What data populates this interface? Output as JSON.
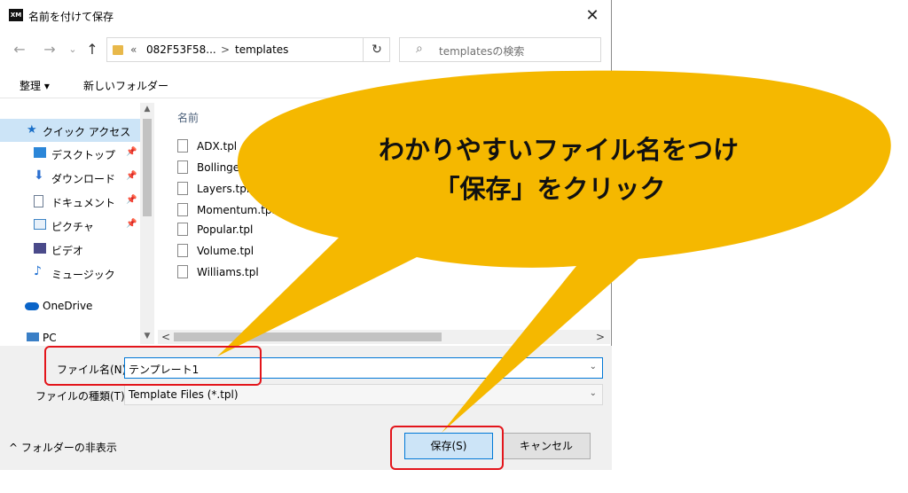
{
  "window": {
    "app_icon": "XM",
    "title": "名前を付けて保存",
    "close_glyph": "✕"
  },
  "nav": {
    "back_glyph": "←",
    "forward_glyph": "→",
    "down_glyph": "⌄",
    "up_glyph": "↑",
    "address": {
      "overflow": "«",
      "segment1": "082F53F58...",
      "chevron": ">",
      "segment2": "templates"
    },
    "refresh_glyph": "↻",
    "search_placeholder": "templatesの検索"
  },
  "toolbar": {
    "organize": "整理 ▾",
    "new_folder": "新しいフォルダー"
  },
  "sidebar": {
    "items": [
      {
        "label": "クイック アクセス",
        "icon": "star-icon",
        "color": "#1a6fc8"
      },
      {
        "label": "デスクトップ",
        "icon": "desktop-icon",
        "color": "#2b86d8",
        "pin": "📌"
      },
      {
        "label": "ダウンロード",
        "icon": "download-icon",
        "color": "#2b6fd0",
        "pin": "📌"
      },
      {
        "label": "ドキュメント",
        "icon": "document-icon",
        "color": "#6a7b92",
        "pin": "📌"
      },
      {
        "label": "ピクチャ",
        "icon": "pictures-icon",
        "color": "#3b83c4",
        "pin": "📌"
      },
      {
        "label": "ビデオ",
        "icon": "video-icon",
        "color": "#4a4a8a"
      },
      {
        "label": "ミュージック",
        "icon": "music-icon",
        "color": "#1d6fd1"
      },
      {
        "label": "OneDrive",
        "icon": "cloud-icon",
        "color": "#0a64c8"
      },
      {
        "label": "PC",
        "icon": "pc-icon",
        "color": "#3a7fc6"
      }
    ]
  },
  "files": {
    "column_name": "名前",
    "items": [
      "ADX.tpl",
      "Bollinger.tpl",
      "Layers.tpl",
      "Momentum.tpl",
      "Popular.tpl",
      "Volume.tpl",
      "Williams.tpl"
    ]
  },
  "scrollbar": {
    "up": "▲",
    "down": "▼",
    "left": "<",
    "right": ">"
  },
  "form": {
    "filename_label": "ファイル名(N):",
    "filename_value": "テンプレート1",
    "filetype_label": "ファイルの種類(T):",
    "filetype_value": "Template Files (*.tpl)",
    "dropdown_caret": "⌄"
  },
  "footer": {
    "hide_folders": "^ フォルダーの非表示",
    "save": "保存(S)",
    "cancel": "キャンセル"
  },
  "callout": {
    "line1": "わかりやすいファイル名をつけ",
    "line2": "「保存」をクリック",
    "fill_color": "#f5b800",
    "outline_color": "#e3151b"
  }
}
